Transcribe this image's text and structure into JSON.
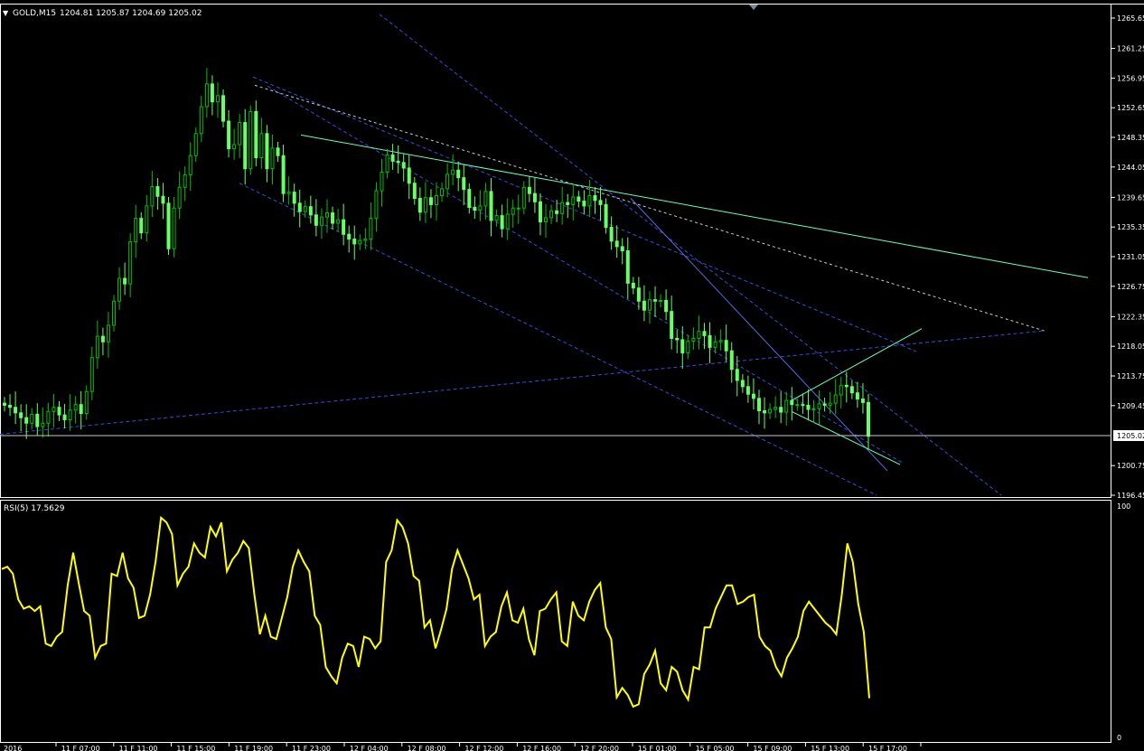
{
  "header": {
    "menu_glyph": "▼",
    "symbol_text": "GOLD,M15",
    "ohlc_text": "1204.81 1205.87 1204.69 1205.02"
  },
  "rsi": {
    "label": "RSI(5) 17.5629",
    "scale_top": "100",
    "scale_bottom": "0"
  },
  "price_axis": {
    "labels": [
      "1265.65",
      "1261.25",
      "1256.95",
      "1252.65",
      "1248.35",
      "1244.05",
      "1239.65",
      "1235.35",
      "1231.05",
      "1226.75",
      "1222.35",
      "1218.05",
      "1213.75",
      "1209.45",
      "1205.02",
      "1200.75",
      "1196.45"
    ],
    "current_price": "1205.02"
  },
  "time_axis": {
    "labels": [
      "2016",
      "11 F 07:00",
      "11 F 11:00",
      "11 F 15:00",
      "11 F 19:00",
      "11 F 23:00",
      "12 F 04:00",
      "12 F 08:00",
      "12 F 12:00",
      "12 F 16:00",
      "12 F 20:00",
      "15 F 01:00",
      "15 F 05:00",
      "15 F 09:00",
      "15 F 13:00",
      "15 F 17:00"
    ]
  },
  "colors": {
    "background": "#000000",
    "grid": "#ffffff",
    "bull_candle": "#00c000",
    "bear_candle": "#66ff66",
    "rsi_line": "#ffff00",
    "channel_blue": "#3a4bd6",
    "trend_cyan": "#66ffbb",
    "dotted_white": "#c8c8c8"
  },
  "chart_data": {
    "type": "line",
    "title": "GOLD,M15",
    "series": [
      {
        "name": "GOLD,M15",
        "kind": "close",
        "values": [
          1209.5,
          1209.2,
          1208.4,
          1207.7,
          1206.9,
          1208.2,
          1206.4,
          1206.9,
          1208.6,
          1209.2,
          1208.1,
          1207.4,
          1208.8,
          1209.6,
          1208.3,
          1211.5,
          1216.4,
          1219.5,
          1218.7,
          1221.1,
          1224.6,
          1227.9,
          1227.1,
          1233.2,
          1236.6,
          1234.5,
          1238.4,
          1241.2,
          1239.8,
          1238.8,
          1232.2,
          1238.1,
          1241.1,
          1242.9,
          1245.7,
          1248.9,
          1252.8,
          1256.1,
          1253.5,
          1254.4,
          1250.7,
          1246.7,
          1247.3,
          1250.5,
          1243.8,
          1252.1,
          1245.4,
          1248.9,
          1243.8,
          1246.8,
          1245.7,
          1240.2,
          1240.4,
          1238.8,
          1237.6,
          1238.3,
          1237.1,
          1235.6,
          1236.8,
          1237.4,
          1235.9,
          1236.4,
          1234.3,
          1233.6,
          1232.9,
          1233.4,
          1233.6,
          1236.6,
          1240.6,
          1243.3,
          1245.8,
          1244.9,
          1244.7,
          1243.9,
          1241.7,
          1239.5,
          1237.5,
          1239.6,
          1238.6,
          1239.9,
          1240.9,
          1243.0,
          1243.6,
          1242.5,
          1240.8,
          1238.2,
          1237.8,
          1238.4,
          1240.5,
          1236.3,
          1237.0,
          1235.1,
          1237.2,
          1238.1,
          1238.1,
          1241.1,
          1240.2,
          1239.0,
          1236.1,
          1236.7,
          1237.7,
          1237.3,
          1238.9,
          1238.6,
          1239.7,
          1239.1,
          1238.4,
          1239.9,
          1239.2,
          1238.6,
          1235.3,
          1233.3,
          1232.5,
          1231.9,
          1227.2,
          1226.5,
          1224.6,
          1223.3,
          1224.8,
          1224.6,
          1224.7,
          1223.1,
          1219.2,
          1219.0,
          1217.1,
          1218.8,
          1219.2,
          1220.2,
          1219.6,
          1217.9,
          1218.7,
          1218.9,
          1217.4,
          1214.7,
          1213.1,
          1212.2,
          1211.1,
          1210.5,
          1208.7,
          1208.4,
          1208.9,
          1209.2,
          1208.5,
          1210.2,
          1209.6,
          1209.6,
          1209.5,
          1208.9,
          1209.0,
          1209.7,
          1209.5,
          1209.8,
          1211.0,
          1212.4,
          1212.2,
          1211.3,
          1210.4,
          1209.9,
          1205.0
        ]
      },
      {
        "name": "RSI(5)",
        "kind": "rsi",
        "values": [
          73,
          74,
          71,
          60,
          56,
          57,
          55,
          57,
          41,
          40,
          44,
          46,
          66,
          80,
          67,
          55,
          53,
          35,
          40,
          41,
          71,
          70,
          80,
          69,
          65,
          52,
          53,
          62,
          76,
          95,
          93,
          88,
          66,
          71,
          74,
          84,
          80,
          78,
          91,
          87,
          93,
          72,
          77,
          80,
          85,
          82,
          62,
          45,
          53,
          44,
          43,
          52,
          61,
          74,
          81,
          76,
          72,
          53,
          49,
          31,
          27,
          24,
          35,
          41,
          40,
          31,
          44,
          43,
          39,
          42,
          76,
          81,
          94,
          91,
          84,
          70,
          68,
          48,
          51,
          39,
          47,
          56,
          73,
          81,
          75,
          69,
          60,
          62,
          40,
          44,
          46,
          57,
          63,
          51,
          50,
          56,
          43,
          36,
          55,
          56,
          60,
          63,
          42,
          40,
          59,
          53,
          51,
          59,
          64,
          67,
          48,
          43,
          18,
          22,
          19,
          14,
          15,
          28,
          32,
          38,
          24,
          21,
          31,
          29,
          21,
          17,
          31,
          30,
          48,
          48,
          56,
          61,
          66,
          66,
          58,
          59,
          61,
          62,
          44,
          40,
          38,
          31,
          27,
          35,
          39,
          44,
          55,
          59,
          56,
          53,
          50,
          48,
          45,
          62,
          84,
          76,
          58,
          46,
          17.6
        ],
        "ylim": [
          0,
          100
        ]
      }
    ],
    "ylim": [
      1196.45,
      1265.65
    ],
    "current_price": 1205.02,
    "grid": false
  }
}
